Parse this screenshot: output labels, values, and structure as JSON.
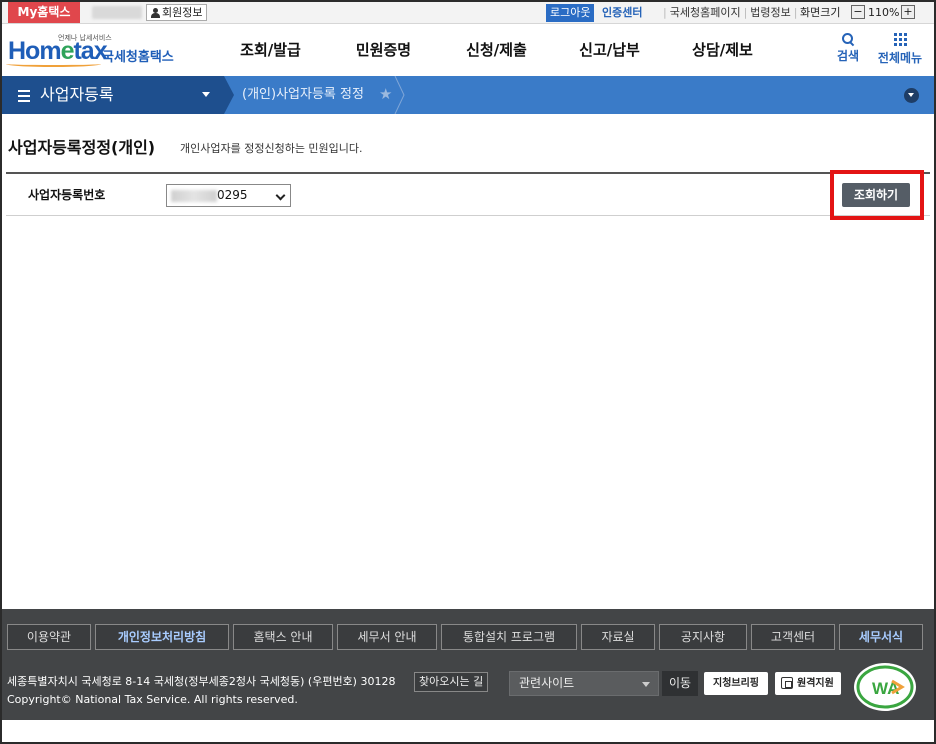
{
  "topbar": {
    "my_hometax": "My홈택스",
    "member_info": "회원정보",
    "logout": "로그아웃",
    "cert_center": "인증센터",
    "links": [
      "국세청홈페이지",
      "법령정보"
    ],
    "screen_size_label": "화면크기",
    "zoom_minus": "−",
    "zoom_value": "110%",
    "zoom_plus": "+"
  },
  "header": {
    "logo_text": "Hometax",
    "logo_kor": "국세청홈택스",
    "logo_small": "언제나 납세서비스",
    "menu": [
      "조회/발급",
      "민원증명",
      "신청/제출",
      "신고/납부",
      "상담/제보"
    ],
    "search_label": "검색",
    "all_menu_label": "전체메뉴"
  },
  "navbar": {
    "section": "사업자등록",
    "breadcrumb": "(개인)사업자등록 정정",
    "star": "★"
  },
  "content": {
    "title": "사업자등록정정(개인)",
    "description": "개인사업자를 정정신청하는 민원입니다.",
    "field_label": "사업자등록번호",
    "business_number_suffix": "0295",
    "search_button": "조회하기"
  },
  "footer": {
    "nav": [
      {
        "label": "이용약관",
        "strong": false
      },
      {
        "label": "개인정보처리방침",
        "strong": true
      },
      {
        "label": "홈택스 안내",
        "strong": false
      },
      {
        "label": "세무서 안내",
        "strong": false
      },
      {
        "label": "통합설치 프로그램",
        "strong": false
      },
      {
        "label": "자료실",
        "strong": false
      },
      {
        "label": "공지사항",
        "strong": false
      },
      {
        "label": "고객센터",
        "strong": false
      },
      {
        "label": "세무서식",
        "strong": true
      }
    ],
    "address": "세종특별자치시 국세청로 8-14 국세청(정부세종2청사 국세청동) (우편번호) 30128",
    "find_way": "찾아오시는 길",
    "copyright": "Copyright© National Tax Service. All rights reserved.",
    "related_sites": "관련사이트",
    "go": "이동",
    "badge_accessibility": "지청브리핑",
    "badge_remote": "원격지원",
    "wa_mark": "WA"
  },
  "colors": {
    "my_tab": "#e0474c",
    "nav_dark": "#1e4f8e",
    "nav_blue": "#3a7bc8",
    "highlight": "#e31414",
    "footer_bg": "#434547"
  }
}
